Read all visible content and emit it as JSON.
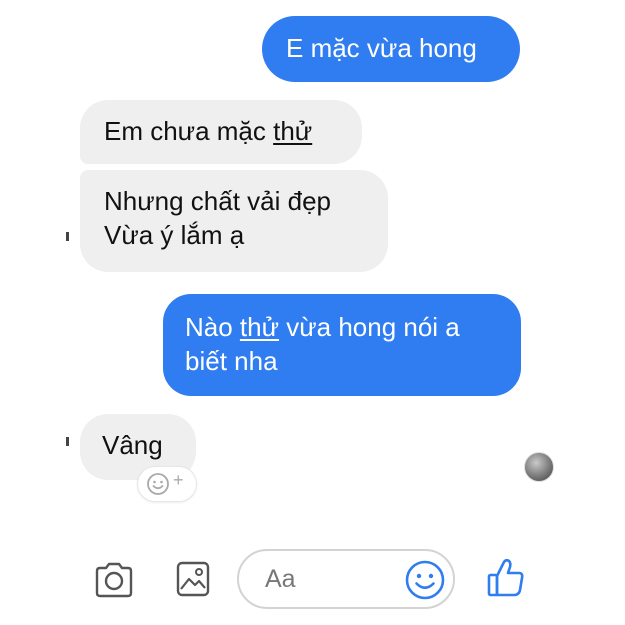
{
  "messages": [
    {
      "type": "outgoing",
      "text": "E mặc vừa hong"
    },
    {
      "type": "incoming",
      "before": "Em chưa mặc ",
      "underlined": "thử"
    },
    {
      "type": "incoming",
      "lines": [
        "Nhưng chất vải đẹp",
        "Vừa ý lắm ạ"
      ]
    },
    {
      "type": "outgoing",
      "line1_before": "Nào ",
      "line1_underlined": "thử",
      "line1_after": " vừa hong nói a",
      "line2": "biết nha"
    },
    {
      "type": "incoming",
      "text": "Vâng"
    }
  ],
  "reaction_button": {
    "plus": "+",
    "icon": "smiley-icon"
  },
  "composer": {
    "placeholder": "Aa",
    "icons": [
      "camera-icon",
      "image-icon",
      "emoji-icon",
      "thumbs-up-icon"
    ]
  },
  "colors": {
    "accent": "#2f7df0",
    "incoming_bg": "#efefef",
    "icon": "#2f7df0"
  }
}
